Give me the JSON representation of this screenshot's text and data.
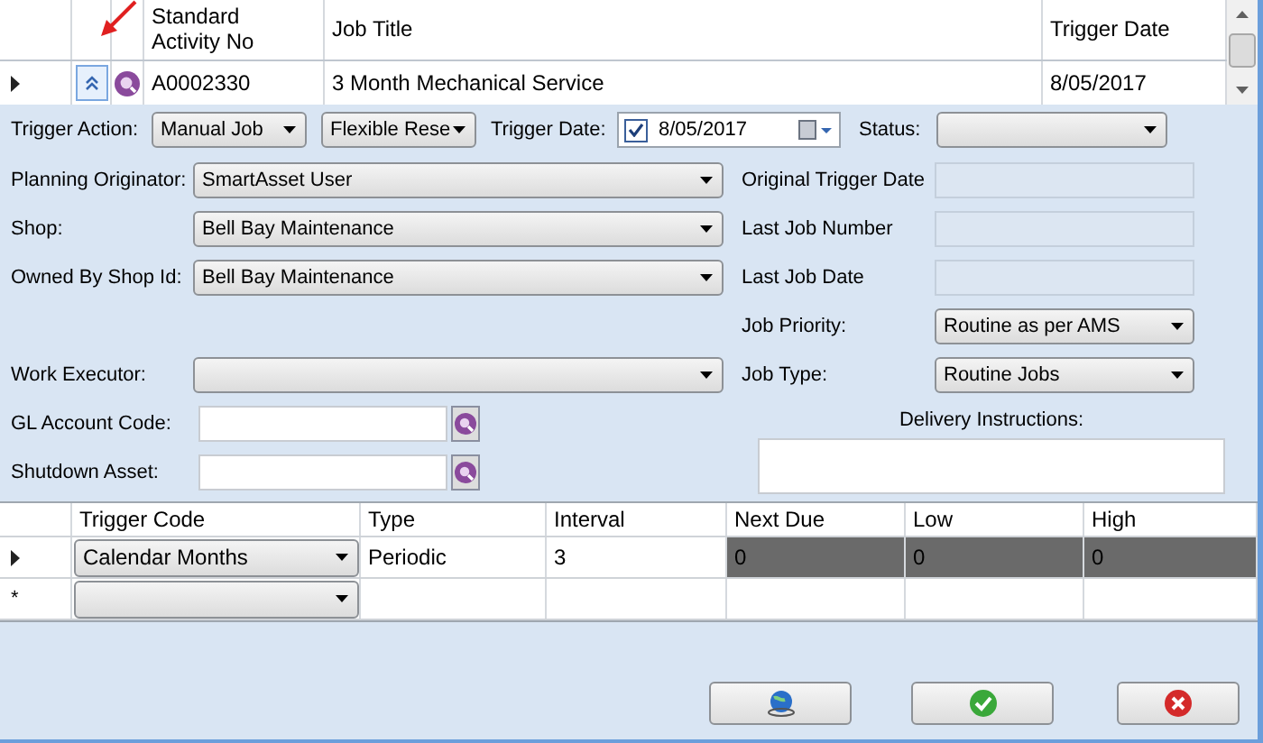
{
  "job_grid": {
    "columns": [
      "Standard\nActivity No",
      "Job Title",
      "Trigger Date"
    ],
    "rows": [
      {
        "current": true,
        "expanded": true,
        "activity_no": "A0002330",
        "job_title": "3 Month Mechanical Service",
        "trigger_date": "8/05/2017"
      }
    ]
  },
  "trigger_row": {
    "trigger_action": {
      "label": "Trigger Action:",
      "value": "Manual Job"
    },
    "trigger_mode": {
      "value": "Flexible Rese"
    },
    "trigger_date": {
      "label": "Trigger Date:",
      "checked": true,
      "value": "8/05/2017"
    },
    "status": {
      "label": "Status:"
    }
  },
  "left_fields": [
    {
      "kind": "select",
      "label": "Planning Originator:",
      "value": "SmartAsset User"
    },
    {
      "kind": "select",
      "label": "Shop:",
      "value": "Bell Bay Maintenance"
    },
    {
      "kind": "select",
      "label": "Owned By Shop Id:",
      "value": "Bell Bay Maintenance"
    },
    {
      "kind": "spacer"
    },
    {
      "kind": "select",
      "label": "Work Executor:"
    },
    {
      "kind": "lookup",
      "label": "GL Account Code:"
    },
    {
      "kind": "lookup",
      "label": "Shutdown Asset:"
    }
  ],
  "right_fields": [
    {
      "kind": "readonly",
      "label": "Original Trigger Date"
    },
    {
      "kind": "readonly",
      "label": "Last Job Number"
    },
    {
      "kind": "readonly",
      "label": "Last Job Date"
    },
    {
      "kind": "select",
      "label": "Job Priority:",
      "value": "Routine as per AMS"
    },
    {
      "kind": "select",
      "label": "Job Type:",
      "value": "Routine Jobs"
    }
  ],
  "delivery_instructions": {
    "label": "Delivery Instructions:"
  },
  "trigger_grid": {
    "columns": [
      "Trigger Code",
      "Type",
      "Interval",
      "Next Due",
      "Low",
      "High"
    ],
    "rows": [
      {
        "current": true,
        "cells": [
          {
            "kind": "combo",
            "text": "Calendar Months"
          },
          {
            "kind": "text",
            "text": "Periodic",
            "disabled": false
          },
          {
            "text": "3",
            "disabled": false
          },
          {
            "text": "0",
            "disabled": true
          },
          {
            "text": "0",
            "disabled": true
          },
          {
            "text": "0",
            "disabled": true
          }
        ]
      }
    ],
    "new_row_marker": "*"
  },
  "buttons": [
    {
      "kind": "web"
    },
    {
      "kind": "ok"
    },
    {
      "kind": "cancel"
    }
  ]
}
